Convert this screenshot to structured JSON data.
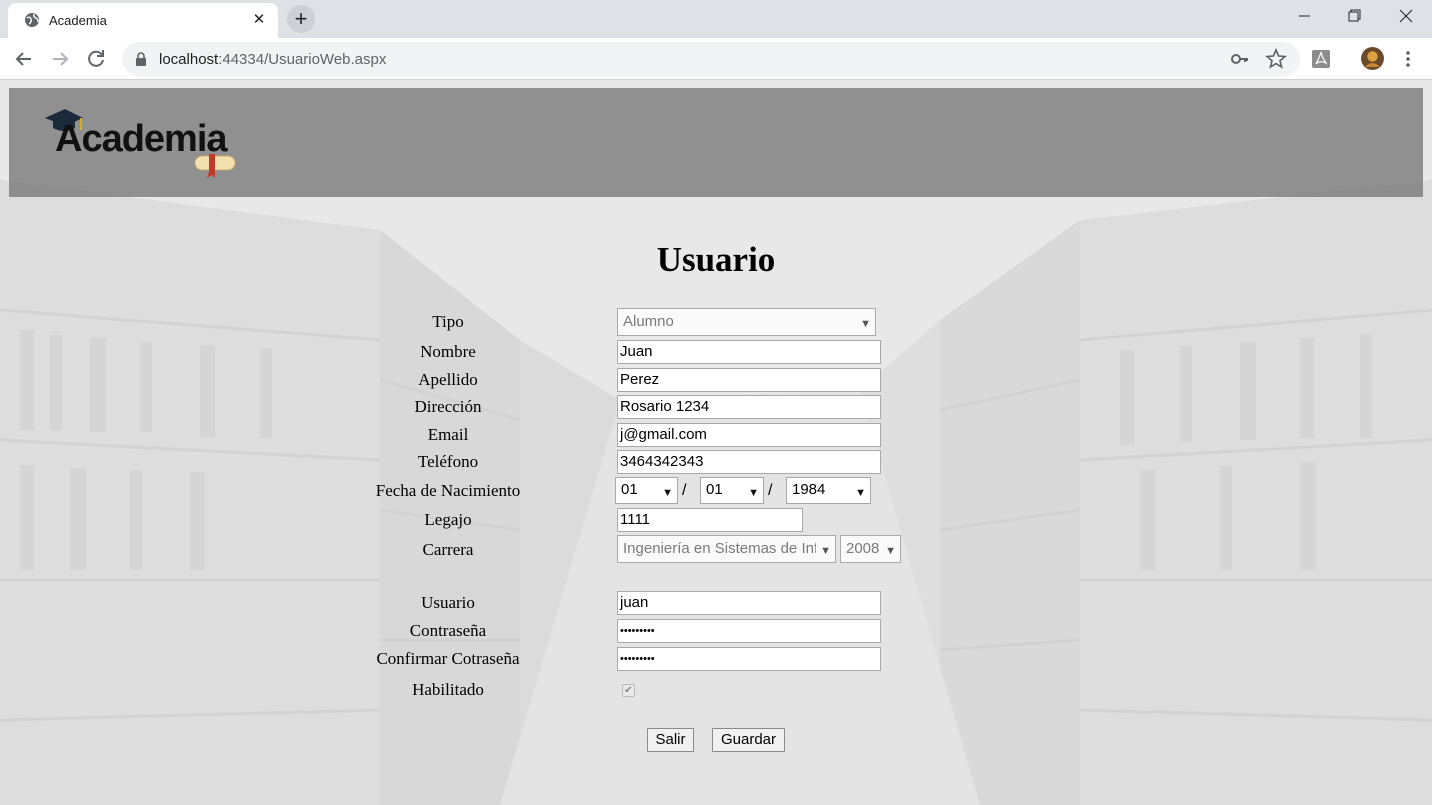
{
  "browser": {
    "tab_title": "Academia",
    "new_tab_symbol": "+",
    "url_host": "localhost",
    "url_path": ":44334/UsuarioWeb.aspx"
  },
  "header": {
    "logo_text": "Academia"
  },
  "form": {
    "title": "Usuario",
    "labels": {
      "tipo": "Tipo",
      "nombre": "Nombre",
      "apellido": "Apellido",
      "direccion": "Dirección",
      "email": "Email",
      "telefono": "Teléfono",
      "fecha": "Fecha de Nacimiento",
      "legajo": "Legajo",
      "carrera": "Carrera",
      "usuario": "Usuario",
      "contrasena": "Contraseña",
      "confirmar": "Confirmar Cotraseña",
      "habilitado": "Habilitado"
    },
    "values": {
      "tipo": "Alumno",
      "nombre": "Juan",
      "apellido": "Perez",
      "direccion": "Rosario 1234",
      "email": "j@gmail.com",
      "telefono": "3464342343",
      "dia": "01",
      "mes": "01",
      "anio": "1984",
      "legajo": "1111",
      "carrera": "Ingeniería en Sistemas de Información",
      "plan": "2008",
      "usuario": "juan",
      "contrasena": "•••••••••",
      "confirmar": "•••••••••",
      "habilitado": true
    },
    "date_separator": "/",
    "buttons": {
      "salir": "Salir",
      "guardar": "Guardar"
    }
  }
}
